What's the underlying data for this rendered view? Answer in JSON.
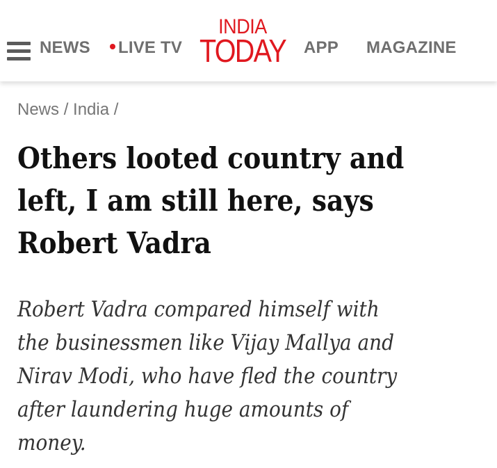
{
  "header": {
    "nav": {
      "news": "NEWS",
      "live_tv": "LIVE TV",
      "app": "APP",
      "magazine": "MAGAZINE"
    },
    "logo": {
      "top": "INDIA",
      "bottom": "TODAY"
    }
  },
  "breadcrumb": {
    "items": [
      "News",
      "India"
    ],
    "separator": "/"
  },
  "article": {
    "headline_lines": [
      "Others looted country and",
      "left, I am still here, says",
      "Robert Vadra"
    ],
    "summary_lines": [
      "Robert Vadra compared himself with",
      "the businessmen like Vijay Mallya and",
      "Nirav Modi, who have fled the country",
      "after laundering huge amounts of",
      "money."
    ]
  },
  "colors": {
    "brand_red": "#e0181f",
    "nav_gray": "#6f6f6f",
    "text": "#111111"
  },
  "icons": {
    "menu": "hamburger-menu-icon",
    "live": "live-dot-icon"
  }
}
